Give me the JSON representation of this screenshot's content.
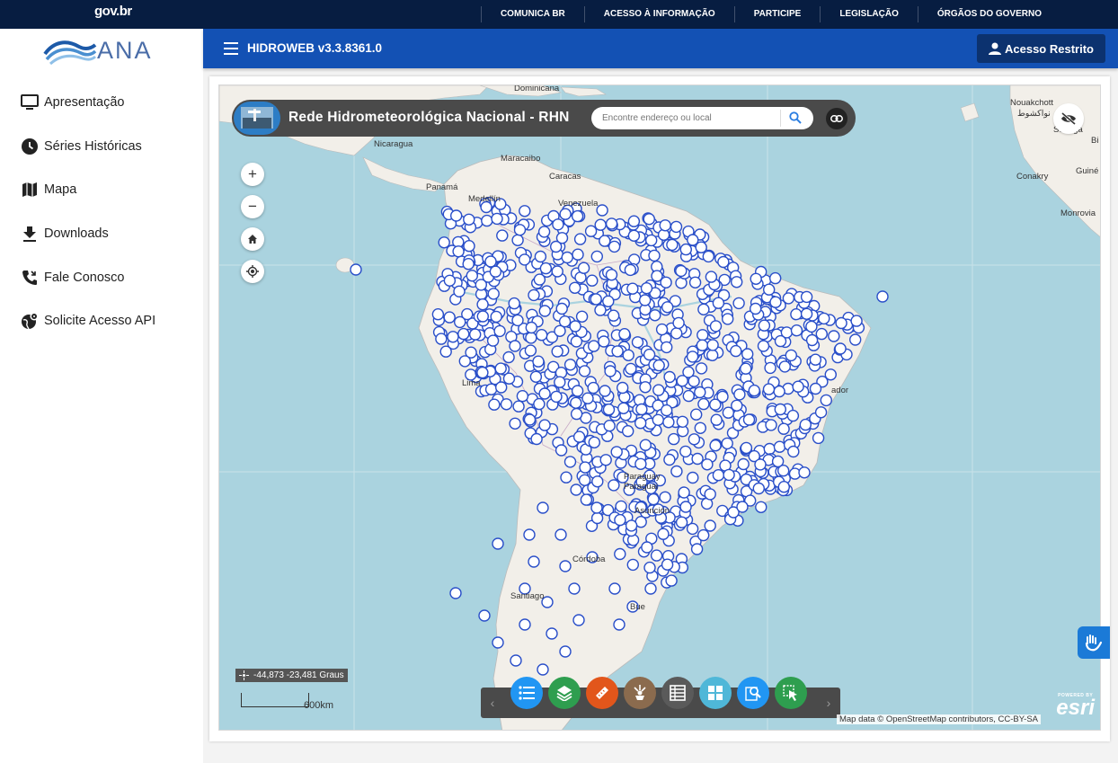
{
  "govbar": {
    "logo": "gov.br",
    "links": [
      "COMUNICA BR",
      "ACESSO À INFORMAÇÃO",
      "PARTICIPE",
      "LEGISLAÇÃO",
      "ÓRGÃOS DO GOVERNO"
    ]
  },
  "brand": {
    "name": "ANA"
  },
  "sidebar": {
    "items": [
      {
        "label": "Apresentação",
        "icon": "monitor-icon"
      },
      {
        "label": "Séries Históricas",
        "icon": "clock-icon"
      },
      {
        "label": "Mapa",
        "icon": "map-icon"
      },
      {
        "label": "Downloads",
        "icon": "download-icon"
      },
      {
        "label": "Fale Conosco",
        "icon": "phone-icon"
      },
      {
        "label": "Solicite Acesso API",
        "icon": "api-globe-icon"
      }
    ]
  },
  "header": {
    "title": "HIDROWEB v3.3.8361.0",
    "login_label": "Acesso Restrito"
  },
  "map": {
    "title": "Rede Hidrometeorológica Nacional - RHN",
    "search_placeholder": "Encontre endereço ou local",
    "coordinates": "-44,873 -23,481 Graus",
    "scale": "600km",
    "attribution": "Map data © OpenStreetMap contributors, CC-BY-SA",
    "esri_powered": "POWERED BY",
    "esri_name": "esri",
    "labels": {
      "dominicana": "Dominicana",
      "nicaragua": "Nicaragua",
      "panama": "Panamá",
      "maracaibo": "Maracaibo",
      "caracas": "Caracas",
      "medellin": "Medellín",
      "venezuela": "Venezuela",
      "lima": "Lima",
      "salvador": "ador",
      "paraguai": "Paraguai",
      "paraguay": "Paraguay",
      "asuncion": "Asunción",
      "cordoba": "Córdoba",
      "santiago": "Santiago",
      "buenos": "Bue",
      "nouakchott": "Nouakchott",
      "nouakchott_ar": "نواكشوط",
      "senegal": "Senega",
      "conakry": "Conakry",
      "monrovia": "Monrovia",
      "guine": "Guiné",
      "bi": "Bi"
    },
    "tools": [
      {
        "name": "legend-tool",
        "color": "#2196f3"
      },
      {
        "name": "layers-tool",
        "color": "#2e9e4f"
      },
      {
        "name": "measure-tool",
        "color": "#e2561b"
      },
      {
        "name": "basemap-tool",
        "color": "#8b6b4e"
      },
      {
        "name": "attribute-table-tool",
        "color": "#5a5a5a"
      },
      {
        "name": "grid-tool",
        "color": "#4fb7d8"
      },
      {
        "name": "query-tool",
        "color": "#2196f3"
      },
      {
        "name": "select-tool",
        "color": "#2e9e4f"
      }
    ]
  }
}
